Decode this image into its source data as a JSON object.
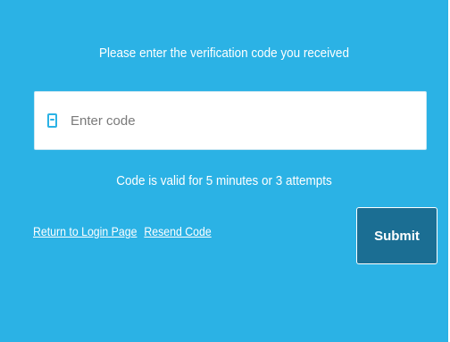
{
  "form": {
    "instruction": "Please enter the verification code you received",
    "code_input": {
      "value": "",
      "placeholder": "Enter code",
      "icon": "mobile-phone-icon"
    },
    "validity_note": "Code is valid for 5 minutes or 3 attempts",
    "links": {
      "return_login": "Return to Login Page",
      "resend_code": "Resend Code"
    },
    "submit_label": "Submit"
  },
  "colors": {
    "background": "#2BB2E5",
    "button": "#1B6E93",
    "text": "#FFFFFF"
  }
}
